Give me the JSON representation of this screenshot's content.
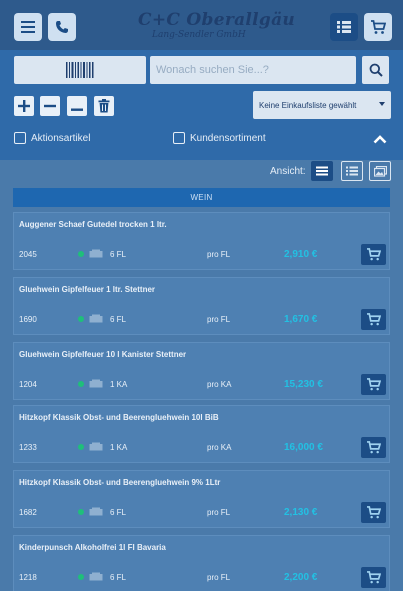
{
  "header": {
    "logo_main": "C+C Oberallgäu",
    "logo_sub": "Lang-Sendler GmbH",
    "icons": [
      "menu-icon",
      "phone-icon",
      "list-view-icon",
      "cart-icon"
    ]
  },
  "search": {
    "placeholder": "Wonach suchen Sie...?",
    "shopping_list_selected": "Keine Einkaufsliste gewählt"
  },
  "filters": {
    "aktionsartikel": "Aktionsartikel",
    "kundensortiment": "Kundensortiment"
  },
  "view": {
    "label": "Ansicht:"
  },
  "section": {
    "title": "WEIN"
  },
  "products": [
    {
      "title": "Auggener Schaef Gutedel trocken 1 ltr.",
      "number": "2045",
      "unit": "6 FL",
      "per": "pro FL",
      "price": "2,910 €"
    },
    {
      "title": "Gluehwein Gipfelfeuer 1 ltr. Stettner",
      "number": "1690",
      "unit": "6 FL",
      "per": "pro FL",
      "price": "1,670 €"
    },
    {
      "title": "Gluehwein Gipfelfeuer 10 l Kanister Stettner",
      "number": "1204",
      "unit": "1 KA",
      "per": "pro KA",
      "price": "15,230 €"
    },
    {
      "title": "Hitzkopf Klassik Obst- und Beerengluehwein 10l BiB",
      "number": "1233",
      "unit": "1 KA",
      "per": "pro KA",
      "price": "16,000 €"
    },
    {
      "title": "Hitzkopf Klassik Obst- und Beerengluehwein 9% 1Ltr",
      "number": "1682",
      "unit": "6 FL",
      "per": "pro FL",
      "price": "2,130 €"
    },
    {
      "title": "Kinderpunsch Alkoholfrei 1l Fl Bavaria",
      "number": "1218",
      "unit": "6 FL",
      "per": "pro FL",
      "price": "2,200 €"
    }
  ],
  "colors": {
    "header_bg": "#2e5a8c",
    "band_bg": "#2f6aa9",
    "list_bg": "#4a7aaa",
    "price": "#22c1e3",
    "available": "#1fbf7a",
    "button_dark": "#1c4d86"
  }
}
